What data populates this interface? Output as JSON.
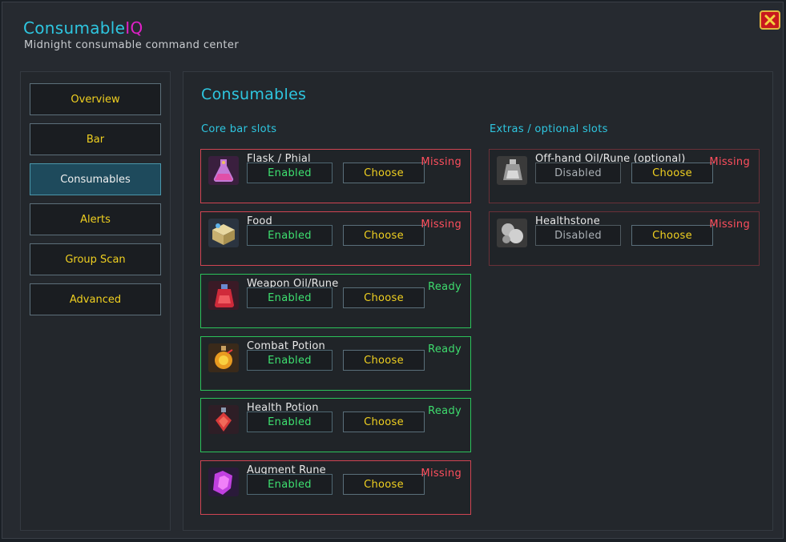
{
  "app": {
    "title_main": "Consumable",
    "title_accent": "IQ",
    "subtitle": "Midnight consumable command center",
    "accent_color": "#2ec6e0",
    "brand_accent_color": "#e020c8"
  },
  "close_icon": "close-x-icon",
  "nav": [
    {
      "label": "Overview",
      "active": false
    },
    {
      "label": "Bar",
      "active": false
    },
    {
      "label": "Consumables",
      "active": true
    },
    {
      "label": "Alerts",
      "active": false
    },
    {
      "label": "Group Scan",
      "active": false
    },
    {
      "label": "Advanced",
      "active": false
    }
  ],
  "main": {
    "title": "Consumables",
    "core_title": "Core bar slots",
    "extras_title": "Extras / optional slots",
    "core_slots": [
      {
        "name": "Flask / Phial",
        "state": "Enabled",
        "choose": "Choose",
        "status": "Missing",
        "icon": "flask-icon"
      },
      {
        "name": "Food",
        "state": "Enabled",
        "choose": "Choose",
        "status": "Missing",
        "icon": "food-icon"
      },
      {
        "name": "Weapon Oil/Rune",
        "state": "Enabled",
        "choose": "Choose",
        "status": "Ready",
        "icon": "weapon-oil-icon"
      },
      {
        "name": "Combat Potion",
        "state": "Enabled",
        "choose": "Choose",
        "status": "Ready",
        "icon": "combat-potion-icon"
      },
      {
        "name": "Health Potion",
        "state": "Enabled",
        "choose": "Choose",
        "status": "Ready",
        "icon": "health-potion-icon"
      },
      {
        "name": "Augment Rune",
        "state": "Enabled",
        "choose": "Choose",
        "status": "Missing",
        "icon": "augment-rune-icon"
      }
    ],
    "extra_slots": [
      {
        "name": "Off-hand Oil/Rune (optional)",
        "state": "Disabled",
        "choose": "Choose",
        "status": "Missing",
        "icon": "offhand-oil-icon"
      },
      {
        "name": "Healthstone",
        "state": "Disabled",
        "choose": "Choose",
        "status": "Missing",
        "icon": "healthstone-icon"
      }
    ]
  },
  "colors": {
    "missing": "#ff4f5e",
    "ready": "#3edc6e",
    "enabled": "#3ee070",
    "choose": "#f0d020"
  }
}
